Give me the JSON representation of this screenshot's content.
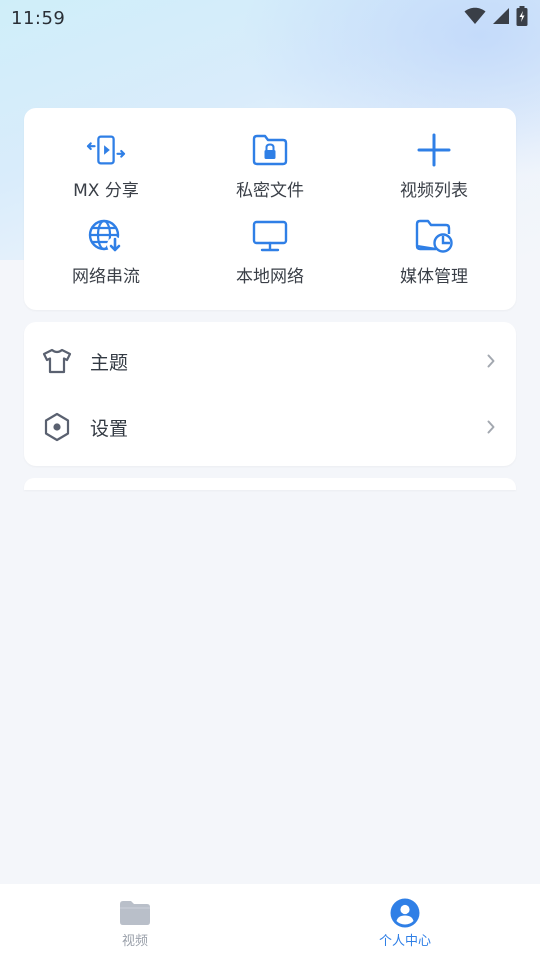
{
  "status_bar": {
    "time": "11:59"
  },
  "colors": {
    "accent": "#2f7fe6",
    "icon_gray": "#5a6170",
    "inactive": "#9aa0aa"
  },
  "quick_actions": [
    {
      "label": "MX 分享",
      "icon": "share-transfer-icon"
    },
    {
      "label": "私密文件",
      "icon": "private-folder-icon"
    },
    {
      "label": "视频列表",
      "icon": "plus-icon"
    },
    {
      "label": "网络串流",
      "icon": "globe-download-icon"
    },
    {
      "label": "本地网络",
      "icon": "monitor-icon"
    },
    {
      "label": "媒体管理",
      "icon": "media-folder-icon"
    }
  ],
  "menu": [
    {
      "label": "主题",
      "icon": "tshirt-icon"
    },
    {
      "label": "设置",
      "icon": "hexagon-settings-icon"
    }
  ],
  "bottom_nav": [
    {
      "label": "视频",
      "icon": "folder-icon",
      "active": false
    },
    {
      "label": "个人中心",
      "icon": "user-icon",
      "active": true
    }
  ]
}
